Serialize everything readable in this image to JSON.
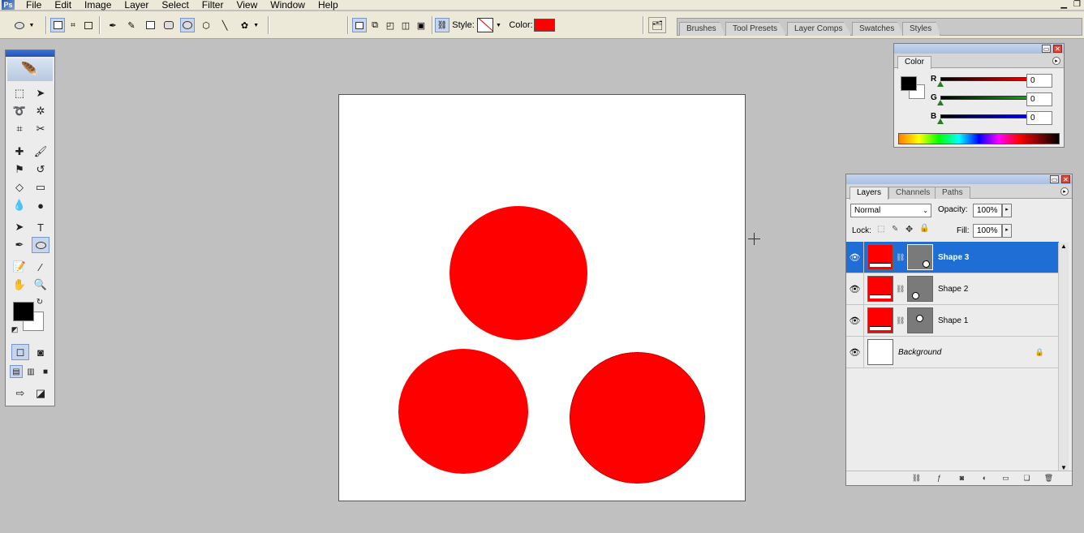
{
  "menubar": {
    "app_logo": "Ps",
    "items": [
      "File",
      "Edit",
      "Image",
      "Layer",
      "Select",
      "Filter",
      "View",
      "Window",
      "Help"
    ],
    "window_controls": [
      "minimize-icon",
      "restore-icon"
    ]
  },
  "options_bar": {
    "style_label": "Style:",
    "color_label": "Color:",
    "color_value": "#ff0000"
  },
  "palette_well": {
    "tabs": [
      "Brushes",
      "Tool Presets",
      "Layer Comps",
      "Swatches",
      "Styles"
    ]
  },
  "toolbox": {
    "foreground": "#000000",
    "background": "#ffffff"
  },
  "canvas": {
    "background": "#ffffff",
    "shape_color": "#ff0000"
  },
  "color_panel": {
    "tab": "Color",
    "channels": [
      {
        "label": "R",
        "value": "0",
        "track": "#ff0000"
      },
      {
        "label": "G",
        "value": "0",
        "track": "#00c000"
      },
      {
        "label": "B",
        "value": "0",
        "track": "#0000ff"
      }
    ]
  },
  "layers_panel": {
    "tabs": [
      "Layers",
      "Channels",
      "Paths"
    ],
    "blend_mode": "Normal",
    "opacity_label": "Opacity:",
    "opacity_value": "100%",
    "lock_label": "Lock:",
    "fill_label": "Fill:",
    "fill_value": "100%",
    "layers": [
      {
        "name": "Shape 3",
        "selected": true
      },
      {
        "name": "Shape 2",
        "selected": false
      },
      {
        "name": "Shape 1",
        "selected": false
      },
      {
        "name": "Background",
        "selected": false
      }
    ]
  }
}
